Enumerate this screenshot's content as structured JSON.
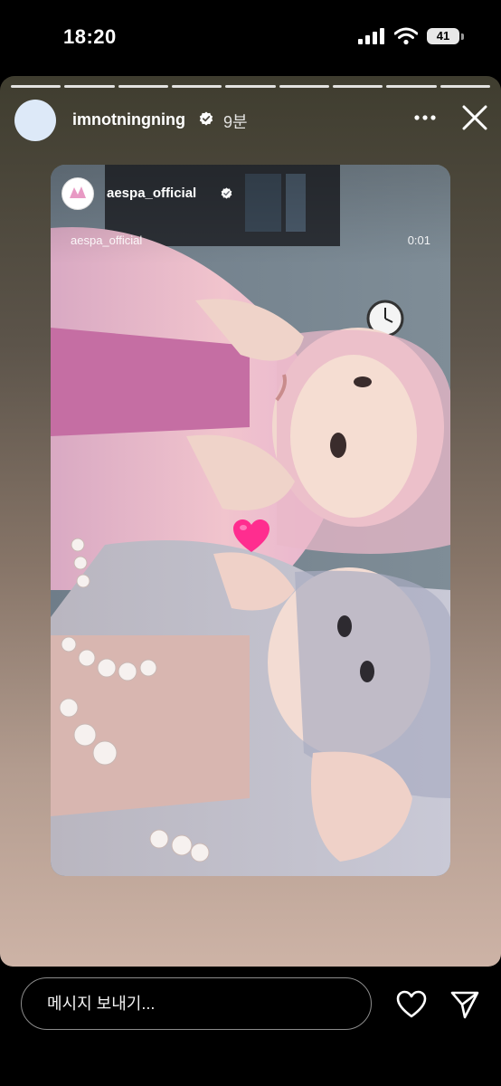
{
  "status_bar": {
    "time": "18:20",
    "battery_level": "41",
    "icons": [
      "signal-icon",
      "wifi-icon",
      "battery-icon"
    ]
  },
  "story": {
    "progress_segments": 9,
    "active_segment": 9,
    "username": "imnotningning",
    "verified": true,
    "time_ago": "9분",
    "icons": {
      "more": "more-horizontal-icon",
      "close": "close-icon"
    },
    "shared_post": {
      "username": "aespa_official",
      "verified": true,
      "reel_label": "aespa_official",
      "reel_time": "0:01",
      "sticker": "pink-heart-icon"
    }
  },
  "bottom_bar": {
    "message_placeholder": "메시지 보내기...",
    "icons": {
      "like": "heart-icon",
      "share": "send-icon"
    }
  },
  "colors": {
    "background": "#000000",
    "verified_badge": "#ffffff",
    "heart_sticker": "#ff2d8f"
  }
}
